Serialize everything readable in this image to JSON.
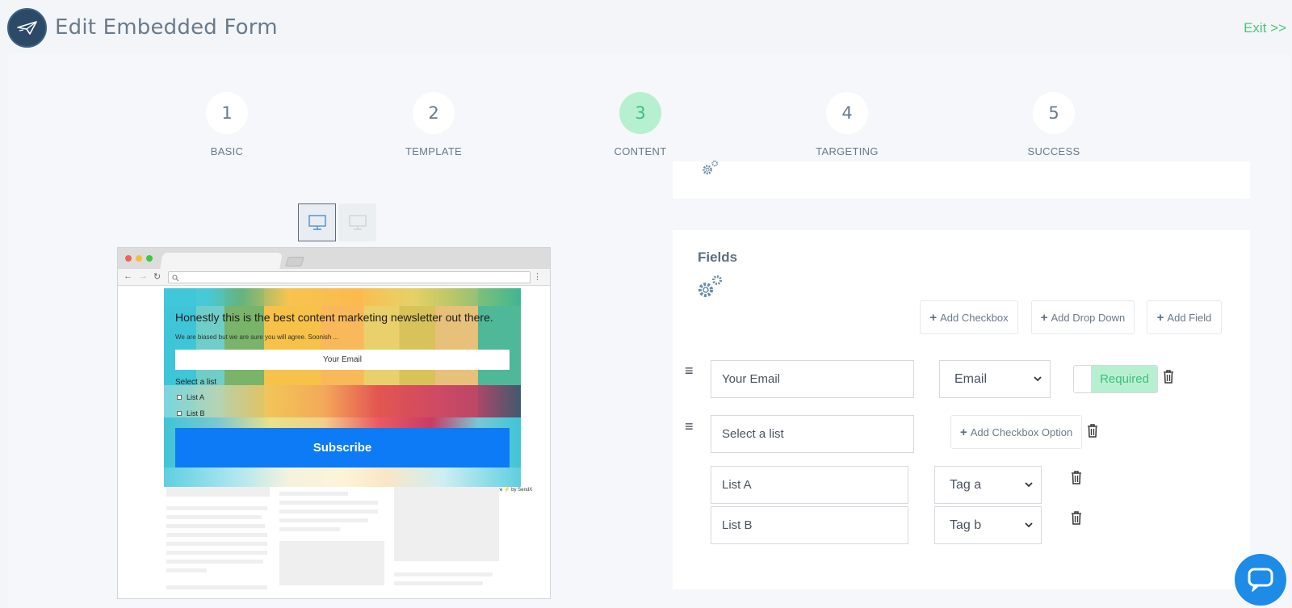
{
  "header": {
    "title": "Edit Embedded Form",
    "exit_label": "Exit >>"
  },
  "stepper": [
    {
      "number": "1",
      "label": "BASIC"
    },
    {
      "number": "2",
      "label": "TEMPLATE"
    },
    {
      "number": "3",
      "label": "CONTENT"
    },
    {
      "number": "4",
      "label": "TARGETING"
    },
    {
      "number": "5",
      "label": "SUCCESS"
    }
  ],
  "active_step": 3,
  "preview": {
    "headline": "Honestly this is the best content marketing newsletter out there.",
    "subtext": "We are biased but we are sure you will agree. Soonish ...",
    "email_placeholder": "Your Email",
    "select_list_label": "Select a list",
    "options": [
      "List A",
      "List B"
    ],
    "submit_label": "Subscribe",
    "made_by": "We're ⚡ by SendX"
  },
  "fields_panel": {
    "title": "Fields",
    "add_checkbox": "Add Checkbox",
    "add_dropdown": "Add Drop Down",
    "add_field": "Add Field",
    "email_field": {
      "label": "Your Email",
      "type": "Email",
      "required_label": "Required"
    },
    "list_field": {
      "label": "Select a list",
      "add_option_label": "Add Checkbox Option"
    },
    "options": [
      {
        "label": "List A",
        "tag": "Tag a"
      },
      {
        "label": "List B",
        "tag": "Tag b"
      }
    ]
  },
  "colors": {
    "accent_green": "#4cc47e",
    "active_step_bg": "#b7f0d0",
    "subscribe_blue": "#0d7bf5",
    "logo_navy": "#2c4a68",
    "chat_blue": "#1e8be6"
  }
}
